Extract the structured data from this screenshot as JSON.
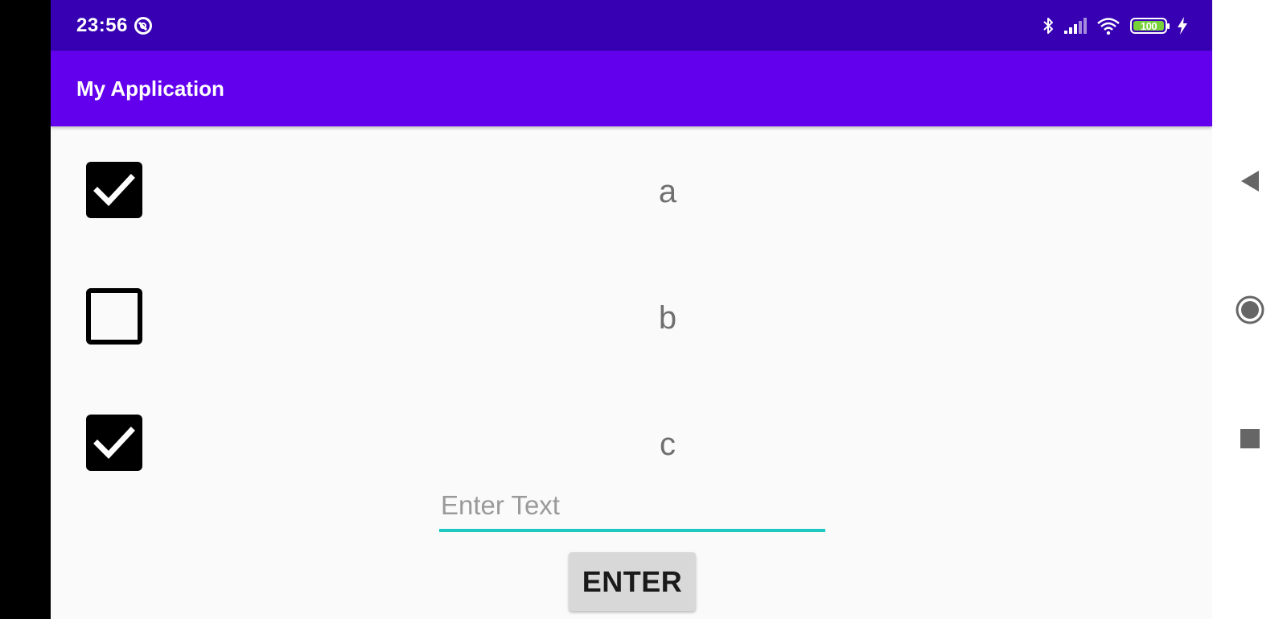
{
  "status_bar": {
    "time": "23:56",
    "battery_level": "100",
    "icons": [
      "no-disturb-icon",
      "bluetooth-icon",
      "signal-icon",
      "wifi-icon",
      "battery-icon",
      "charging-icon"
    ]
  },
  "app_bar": {
    "title": "My Application"
  },
  "checkboxes": [
    {
      "label": "a",
      "checked": true
    },
    {
      "label": "b",
      "checked": false
    },
    {
      "label": "c",
      "checked": true
    }
  ],
  "text_input": {
    "placeholder": "Enter Text",
    "value": ""
  },
  "enter_button": {
    "label": "ENTER"
  },
  "nav_bar": {
    "icons": [
      "back-icon",
      "home-icon",
      "recents-icon"
    ]
  },
  "colors": {
    "status_bar": "#3700b3",
    "app_bar": "#6200ee",
    "input_underline": "#1dc8c2",
    "battery_fill": "#76d13a"
  }
}
